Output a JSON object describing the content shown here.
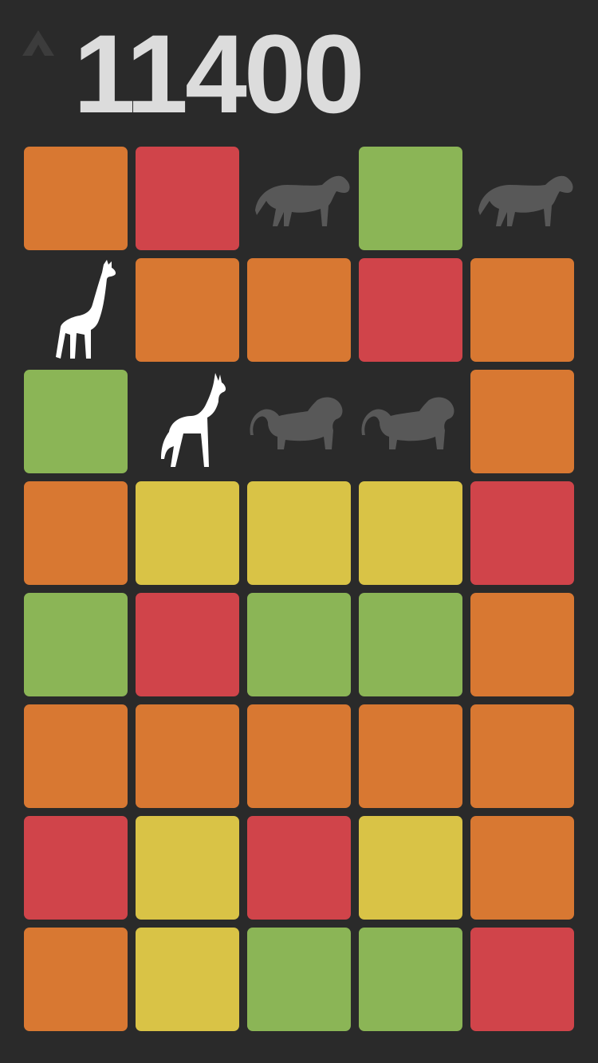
{
  "header": {
    "score": "11400",
    "menu_icon": "chevron-up-icon"
  },
  "colors": {
    "background": "#2a2a2a",
    "orange": "#d87832",
    "red": "#d0444a",
    "green": "#8bb556",
    "yellow": "#d9c346",
    "animal_active": "#ffffff",
    "animal_inactive": "#585858",
    "score_text": "#dcdcdc"
  },
  "board": {
    "columns": 5,
    "rows": [
      [
        "orange",
        "red",
        "zebra-dim",
        "green",
        "zebra-dim"
      ],
      [
        "giraffe",
        "orange",
        "orange",
        "red",
        "orange"
      ],
      [
        "green",
        "gazelle",
        "baboon-dim",
        "baboon-dim",
        "orange"
      ],
      [
        "orange",
        "yellow",
        "yellow",
        "yellow",
        "red"
      ],
      [
        "green",
        "red",
        "green",
        "green",
        "orange"
      ],
      [
        "orange",
        "orange",
        "orange",
        "orange",
        "orange"
      ],
      [
        "red",
        "yellow",
        "red",
        "yellow",
        "orange"
      ],
      [
        "orange",
        "yellow",
        "green",
        "green",
        "red"
      ]
    ]
  }
}
